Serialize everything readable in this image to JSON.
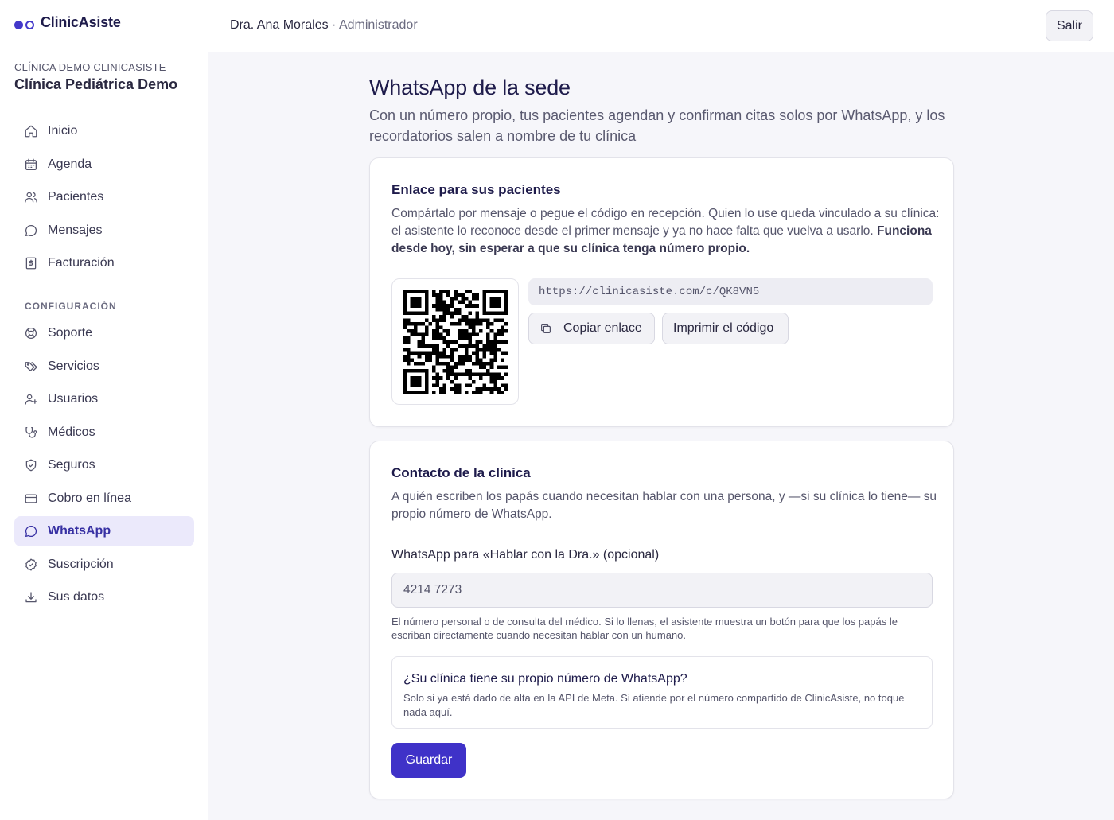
{
  "brand": {
    "name": "ClinicAsiste"
  },
  "clinic": {
    "caption": "CLÍNICA DEMO CLINICASISTE",
    "name": "Clínica Pediátrica Demo"
  },
  "sidebar": {
    "main_items": [
      {
        "label": "Inicio",
        "icon": "home-icon"
      },
      {
        "label": "Agenda",
        "icon": "calendar-icon"
      },
      {
        "label": "Pacientes",
        "icon": "users-icon"
      },
      {
        "label": "Mensajes",
        "icon": "chat-icon"
      },
      {
        "label": "Facturación",
        "icon": "receipt-icon"
      }
    ],
    "section_label": "CONFIGURACIÓN",
    "config_items": [
      {
        "label": "Soporte",
        "icon": "lifebuoy-icon"
      },
      {
        "label": "Servicios",
        "icon": "tags-icon"
      },
      {
        "label": "Usuarios",
        "icon": "user-plus-icon"
      },
      {
        "label": "Médicos",
        "icon": "stethoscope-icon"
      },
      {
        "label": "Seguros",
        "icon": "shield-icon"
      },
      {
        "label": "Cobro en línea",
        "icon": "credit-card-icon"
      },
      {
        "label": "WhatsApp",
        "icon": "chat-icon",
        "active": true
      },
      {
        "label": "Suscripción",
        "icon": "badge-check-icon"
      },
      {
        "label": "Sus datos",
        "icon": "download-icon"
      }
    ]
  },
  "header": {
    "user_name": "Dra. Ana Morales",
    "separator": " · ",
    "role": "Administrador",
    "logout_label": "Salir"
  },
  "page": {
    "title": "WhatsApp de la sede",
    "subtitle": "Con un número propio, tus pacientes agendan y confirman citas solos por WhatsApp, y los recordatorios salen a nombre de tu clínica"
  },
  "link_card": {
    "title": "Enlace para sus pacientes",
    "description": "Compártalo por mensaje o pegue el código en recepción. Quien lo use queda vinculado a su clínica: el asistente lo reconoce desde el primer mensaje y ya no hace falta que vuelva a usarlo.",
    "description_bold": "Funciona desde hoy, sin esperar a que su clínica tenga número propio.",
    "link": "https://clinicasiste.com/c/QK8VN5",
    "copy_label": "Copiar enlace",
    "print_label": "Imprimir el código"
  },
  "contact_card": {
    "title": "Contacto de la clínica",
    "description": "A quién escriben los papás cuando necesitan hablar con una persona, y —si su clínica lo tiene— su propio número de WhatsApp.",
    "field_label": "WhatsApp para «Hablar con la Dra.» (opcional)",
    "field_value": "4214 7273",
    "help": "El número personal o de consulta del médico. Si lo llenas, el asistente muestra un botón para que los papás le escriban directamente cuando necesitan hablar con un humano.",
    "own_number_title": "¿Su clínica tiene su propio número de WhatsApp?",
    "own_number_text": "Solo si ya está dado de alta en la API de Meta. Si atiende por el número compartido de ClinicAsiste, no toque nada aquí.",
    "save_label": "Guardar"
  },
  "colors": {
    "accent": "#3f32c8",
    "active_bg": "#ebe9fb",
    "brand": "#4338ca"
  }
}
